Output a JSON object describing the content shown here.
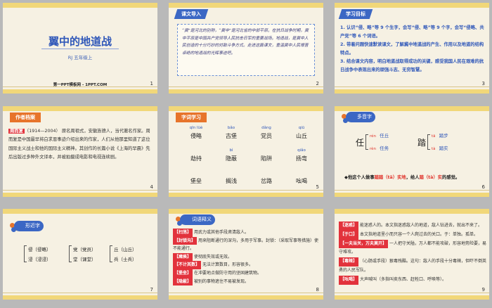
{
  "slide1": {
    "title": "翼中的地道战",
    "subtitle": "RJ  五年级上",
    "site": "第一PPT模板网 - 1PPT.COM",
    "num": "1"
  },
  "slide2": {
    "tag": "课文导入",
    "num": "2",
    "text": "“冀”是河北的别称，“冀中”是河北省的中部平原。在抗日战争时期，冀中平原是中国共产党领导人民抗击日军的重要战场。地道战，是冀中人民创造的十分巧妙的对敌斗争方式。走进这篇课文，重温冀中人民艰苦卓绝的地道战的光辉事迹吧。"
  },
  "slide3": {
    "tag": "学习目标",
    "num": "3",
    "goals": [
      "1. 认识“侵、略”等 9 个生字，会写“侵、略”等 9 个字，会写“侵略、共产党”等 6 个词语。",
      "2. 带着问题快速默读课文，了解冀中地道战的产生、作用以及地道的结构特点。",
      "3. 结合课文内容，明白地道战取得成功的关键，感受我国人民在艰难的抗日战争中表现出来的顽强斗志、无穷智慧。"
    ]
  },
  "slide4": {
    "tag": "作者档案",
    "num": "4",
    "name": "周而复",
    "text": "（1914—2004）  原名周祖式，安徽旌德人，当代著名作家。周而复是中国最早将白求恩事迹介绍出来的作家，人们从他那里知道了这位国际主义战士和他的国际主义精神。其创作的长篇小说《上海的早晨》先后出版过多种外文译本，并被拍摄成电影和电视连续剧。"
  },
  "slide5": {
    "tag": "字词学习",
    "num": "5",
    "rows": [
      [
        {
          "py": "qīn lüè",
          "w": "侵略"
        },
        {
          "py": "bǎo",
          "w": "古堡"
        },
        {
          "py": "dǎng",
          "w": "党员"
        },
        {
          "py": "qiū",
          "w": "山丘"
        }
      ],
      [
        {
          "py": "",
          "w": "劫持"
        },
        {
          "py": "bì",
          "w": "隐蔽"
        },
        {
          "py": "",
          "w": "陷阱"
        },
        {
          "py": "qiǎo",
          "w": "扬弯"
        }
      ],
      [
        {
          "py": "",
          "w": "堡垒"
        },
        {
          "py": "",
          "w": "搁浅"
        },
        {
          "py": "",
          "w": "岔路"
        },
        {
          "py": "",
          "w": "吆喝"
        }
      ]
    ]
  },
  "slide6": {
    "tag": "多音字",
    "num": "6",
    "left": {
      "char": "任",
      "items": [
        {
          "py": "rén",
          "w": "任丘"
        },
        {
          "py": "rèn",
          "w": "任务"
        }
      ]
    },
    "right": {
      "char": "踏",
      "items": [
        {
          "py": "tā",
          "w": "踏步"
        },
        {
          "py": "tà",
          "w": "踏实"
        }
      ]
    },
    "note_a": "◆他这个人做事",
    "note_b": "踏踏（tā）实地",
    "note_c": "，给人",
    "note_d": "踏（tà）实",
    "note_e": "的感觉。"
  },
  "slide7": {
    "tag": "形近字",
    "num": "7",
    "groups": [
      {
        "a": "侵（侵略）",
        "b": "浸（浸浸）"
      },
      {
        "a": "党（党员）",
        "b": "堂（课堂）"
      },
      {
        "a": "丘（山丘）",
        "b": "兵（士兵）"
      }
    ]
  },
  "slide8": {
    "tag": "词语释义",
    "num": "8",
    "items": [
      {
        "t": "【扫荡】",
        "d": "用武力或其他手段肃清敌人。"
      },
      {
        "t": "【封锁沟】",
        "d": "用来阻断通行的深沟，多用于军事。封锁：（采取军事等措施）使不能通行。"
      },
      {
        "t": "【瘫痪】",
        "d": "使彻底失效或无效。"
      },
      {
        "t": "【不计其数】",
        "d": "无法计算数目，形容很多。"
      },
      {
        "t": "【堡垒】",
        "d": "在冲要地点做防守用的坚固建筑物。"
      },
      {
        "t": "【隐蔽】",
        "d": "被别的事物遮住不易被发现。"
      }
    ]
  },
  "slide9": {
    "num": "9",
    "items": [
      {
        "t": "【迷惑】",
        "d": "能迷惑人的。本文指迷惑敌人的地道，敌人钻进去，就出不来了。"
      },
      {
        "t": "【于口】",
        "d": "本文指地道里小而只容一个人爬过去的关口。于：单独。孤单。"
      },
      {
        "t": "【一夫当关，万夫莫开】",
        "d": "一人把守关隘，万人都不能攻破，形容地势险要，易守难攻。"
      },
      {
        "t": "【毒辣】",
        "d": "（心肠或手段）狠毒残酷。这句：敌人的手段十分毒辣，但吓不倒英勇的人民军队。"
      },
      {
        "t": "【吆喝】",
        "d": "大声喊叫（多指叫卖东西、赶牲口、呼唤等）。"
      }
    ]
  }
}
